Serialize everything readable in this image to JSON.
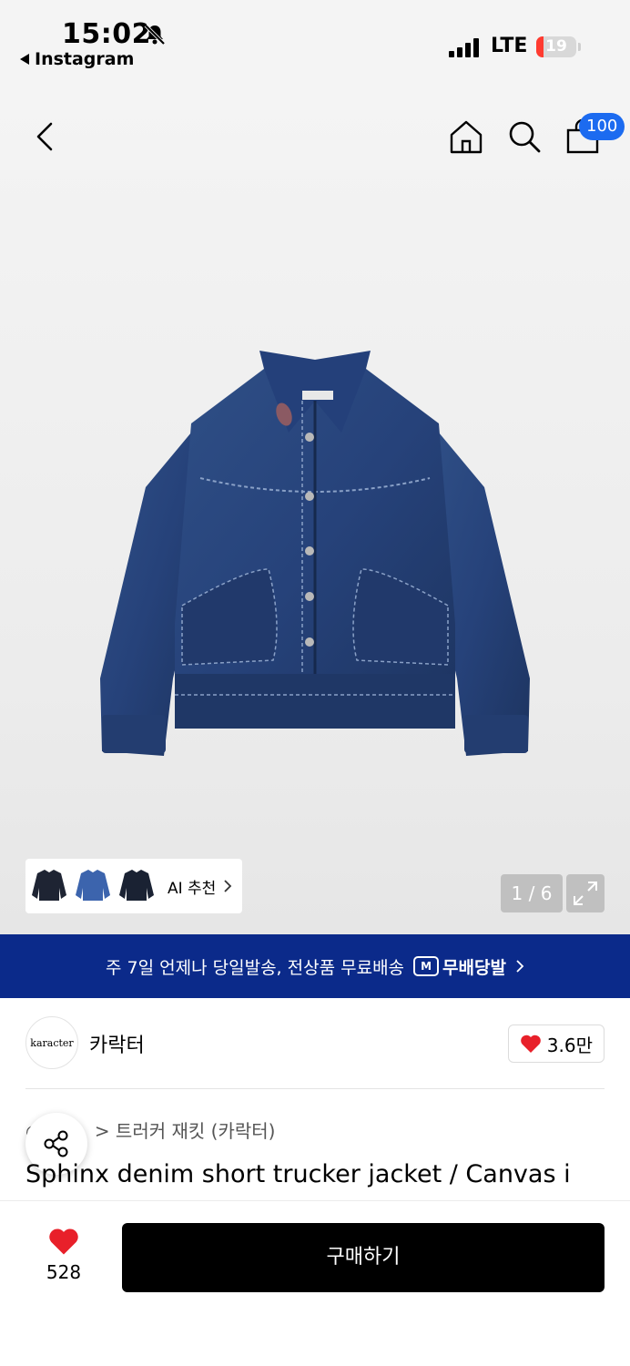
{
  "status_bar": {
    "time": "15:02",
    "back_app": "Instagram",
    "network": "LTE",
    "battery": "19",
    "battery_level": 0.19
  },
  "header": {
    "cart_count": "100"
  },
  "gallery": {
    "ai_label": "AI 추천",
    "page_indicator": "1 / 6"
  },
  "banner": {
    "text": "주 7일 언제나 당일발송, 전상품 무료배송",
    "logo_text": "무배당발",
    "logo_icon_text": "M"
  },
  "brand": {
    "logo_text": "karacter",
    "name": "카락터",
    "likes": "3.6만"
  },
  "product": {
    "breadcrumb_leading": "○",
    "breadcrumb": "> 트러커 재킷 (카락터)",
    "title": "Sphinx denim short trucker jacket / Canvas i"
  },
  "bottom": {
    "wish_count": "528",
    "buy_label": "구매하기"
  },
  "colors": {
    "banner_bg": "#0b2a8a",
    "badge_bg": "#1c6bf0",
    "heart": "#e8202a",
    "buy_bg": "#000000"
  }
}
